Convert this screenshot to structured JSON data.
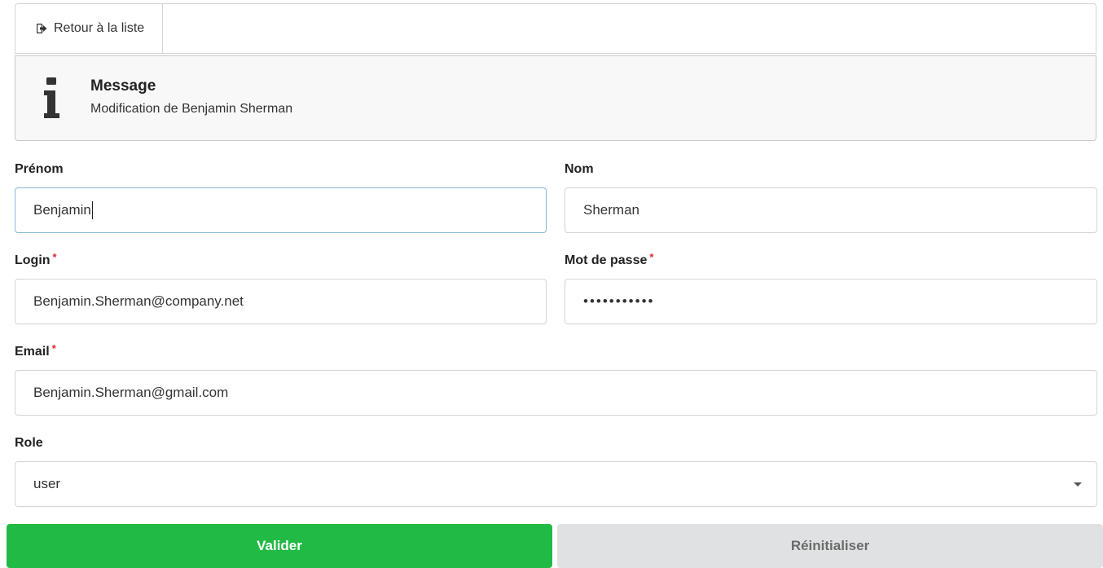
{
  "toolbar": {
    "back_label": "Retour à la liste",
    "back_icon": "sign-out-icon"
  },
  "message": {
    "icon": "info-icon",
    "title": "Message",
    "text": "Modification de Benjamin Sherman"
  },
  "form": {
    "first_name": {
      "label": "Prénom",
      "value": "Benjamin"
    },
    "last_name": {
      "label": "Nom",
      "value": "Sherman"
    },
    "login": {
      "label": "Login",
      "required_mark": "*",
      "value": "Benjamin.Sherman@company.net"
    },
    "password": {
      "label": "Mot de passe",
      "required_mark": "*",
      "masked_value": "•••••••••••"
    },
    "email": {
      "label": "Email",
      "required_mark": "*",
      "value": "Benjamin.Sherman@gmail.com"
    },
    "role": {
      "label": "Role",
      "selected": "user"
    }
  },
  "actions": {
    "submit_label": "Valider",
    "reset_label": "Réinitialiser"
  },
  "colors": {
    "primary": "#21ba45",
    "secondary": "#e0e1e2",
    "required": "#db2828",
    "focus_border": "#85b7d9"
  }
}
